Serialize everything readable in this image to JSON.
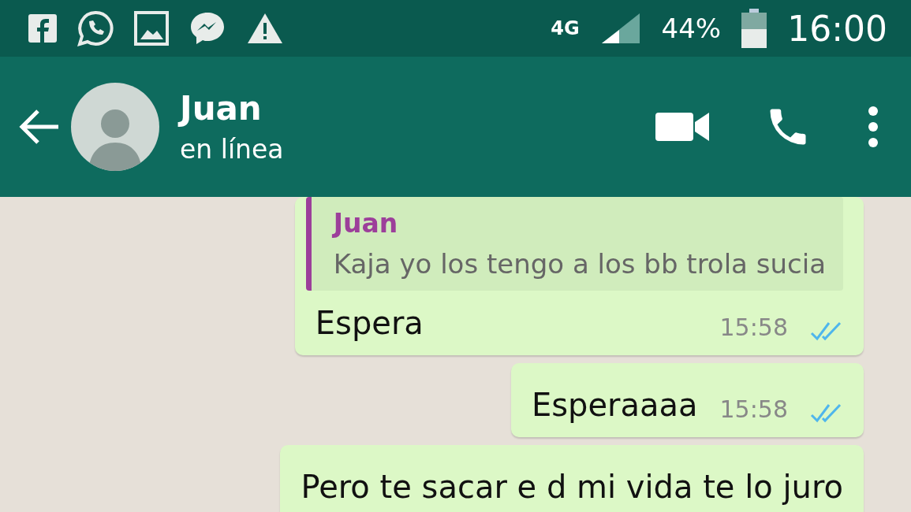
{
  "status_bar": {
    "network": "4G",
    "battery": "44%",
    "time": "16:00"
  },
  "header": {
    "name": "Juan",
    "status": "en línea"
  },
  "messages": [
    {
      "kind": "outgoing",
      "quote": {
        "author": "Juan",
        "text": "Kaja yo los tengo a los bb trola sucia"
      },
      "text": "Espera",
      "time": "15:58",
      "read": true
    },
    {
      "kind": "outgoing",
      "text": "Esperaaaa",
      "time": "15:58",
      "read": true
    },
    {
      "kind": "outgoing",
      "text": "Pero te sacar e d mi vida te lo juro"
    }
  ]
}
